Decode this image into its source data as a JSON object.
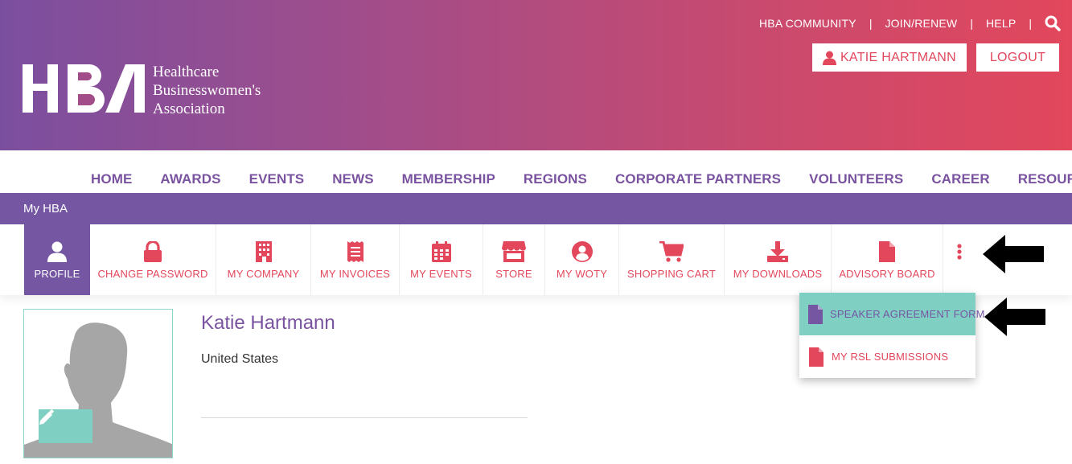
{
  "header": {
    "logo": {
      "letters": "HBA",
      "line1": "Healthcare",
      "line2": "Businesswomen's",
      "line3": "Association"
    },
    "top_links": [
      "HBA COMMUNITY",
      "JOIN/RENEW",
      "HELP"
    ],
    "separator": "|",
    "user_button_label": "KATIE HARTMANN",
    "logout_label": "LOGOUT",
    "colors": {
      "gradient_start": "#7b4f9f",
      "gradient_end": "#e2475c"
    }
  },
  "main_nav": [
    "HOME",
    "AWARDS",
    "EVENTS",
    "NEWS",
    "MEMBERSHIP",
    "REGIONS",
    "CORPORATE PARTNERS",
    "VOLUNTEERS",
    "CAREER",
    "RESOURCES"
  ],
  "section_bar": {
    "title": "My HBA"
  },
  "profile_tabs": [
    {
      "label": "PROFILE",
      "icon": "user-icon",
      "active": true
    },
    {
      "label": "CHANGE PASSWORD",
      "icon": "lock-icon"
    },
    {
      "label": "MY COMPANY",
      "icon": "building-icon"
    },
    {
      "label": "MY INVOICES",
      "icon": "receipt-icon"
    },
    {
      "label": "MY EVENTS",
      "icon": "calendar-icon"
    },
    {
      "label": "STORE",
      "icon": "store-icon"
    },
    {
      "label": "MY WOTY",
      "icon": "user-circle-icon"
    },
    {
      "label": "SHOPPING CART",
      "icon": "cart-icon"
    },
    {
      "label": "MY DOWNLOADS",
      "icon": "download-icon"
    },
    {
      "label": "ADVISORY BOARD",
      "icon": "file-icon"
    }
  ],
  "more_menu": {
    "icon": "more-vertical-icon",
    "items": [
      {
        "label": "SPEAKER AGREEMENT FORM",
        "icon": "file-icon",
        "highlighted": true
      },
      {
        "label": "MY RSL SUBMISSIONS",
        "icon": "file-icon",
        "highlighted": false
      }
    ]
  },
  "profile": {
    "name": "Katie Hartmann",
    "country": "United States"
  },
  "colors": {
    "purple": "#7556a3",
    "coral": "#e2475c",
    "teal": "#7fd0c3"
  }
}
